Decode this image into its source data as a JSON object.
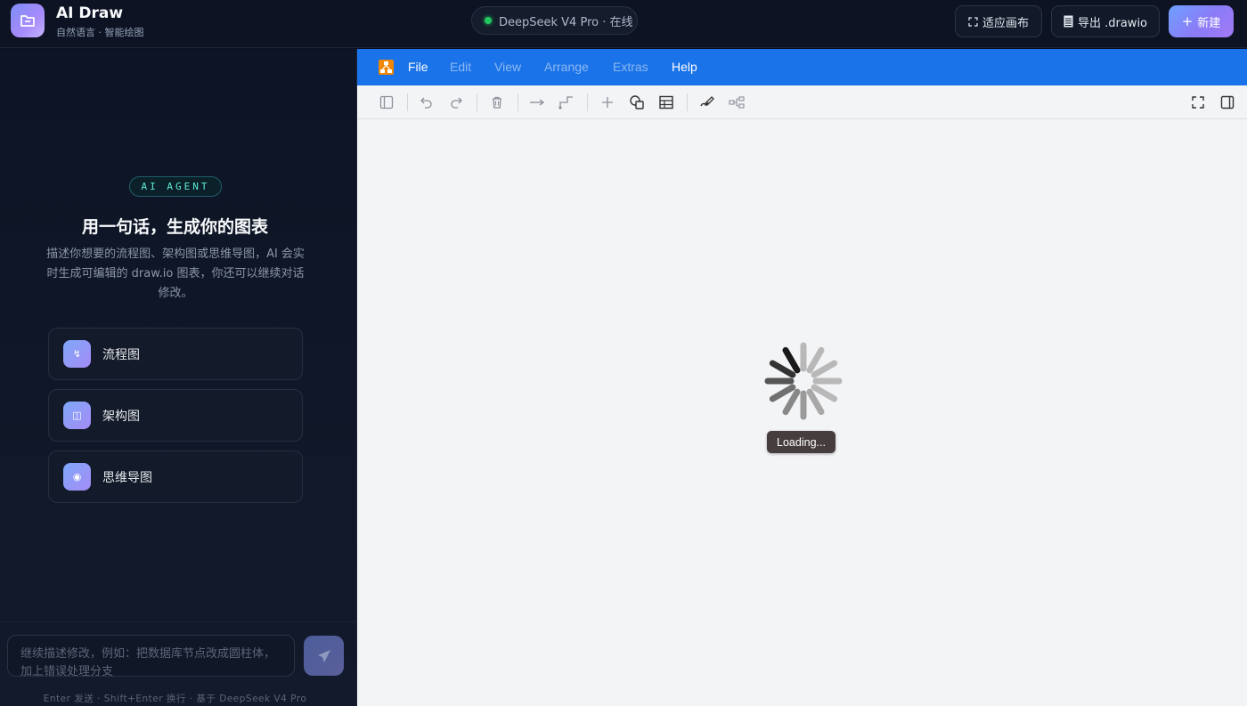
{
  "header": {
    "app_title": "AI Draw",
    "app_subtitle": "自然语言 · 智能绘图",
    "model_status": "DeepSeek V4 Pro · 在线",
    "fit_canvas_label": "适应画布",
    "export_label": "导出 .drawio",
    "new_label": "新建"
  },
  "sidebar": {
    "badge": "AI AGENT",
    "title": "用一句话，生成你的图表",
    "description": "描述你想要的流程图、架构图或思维导图，AI 会实时生成可编辑的 draw.io 图表，你还可以继续对话修改。",
    "templates": [
      {
        "label": "流程图",
        "icon": "flow-icon"
      },
      {
        "label": "架构图",
        "icon": "architecture-icon"
      },
      {
        "label": "思维导图",
        "icon": "mindmap-icon"
      }
    ],
    "input_placeholder": "继续描述修改，例如：把数据库节点改成圆柱体，加上错误处理分支",
    "hint": "Enter 发送 · Shift+Enter 换行 · 基于 DeepSeek V4 Pro"
  },
  "editor": {
    "menu": [
      {
        "label": "File",
        "enabled": true
      },
      {
        "label": "Edit",
        "enabled": false
      },
      {
        "label": "View",
        "enabled": false
      },
      {
        "label": "Arrange",
        "enabled": false
      },
      {
        "label": "Extras",
        "enabled": false
      },
      {
        "label": "Help",
        "enabled": true
      }
    ],
    "loading_text": "Loading..."
  },
  "colors": {
    "accent": "#1a73e8",
    "status_online": "#22c55e",
    "badge_text": "#5eead4"
  }
}
